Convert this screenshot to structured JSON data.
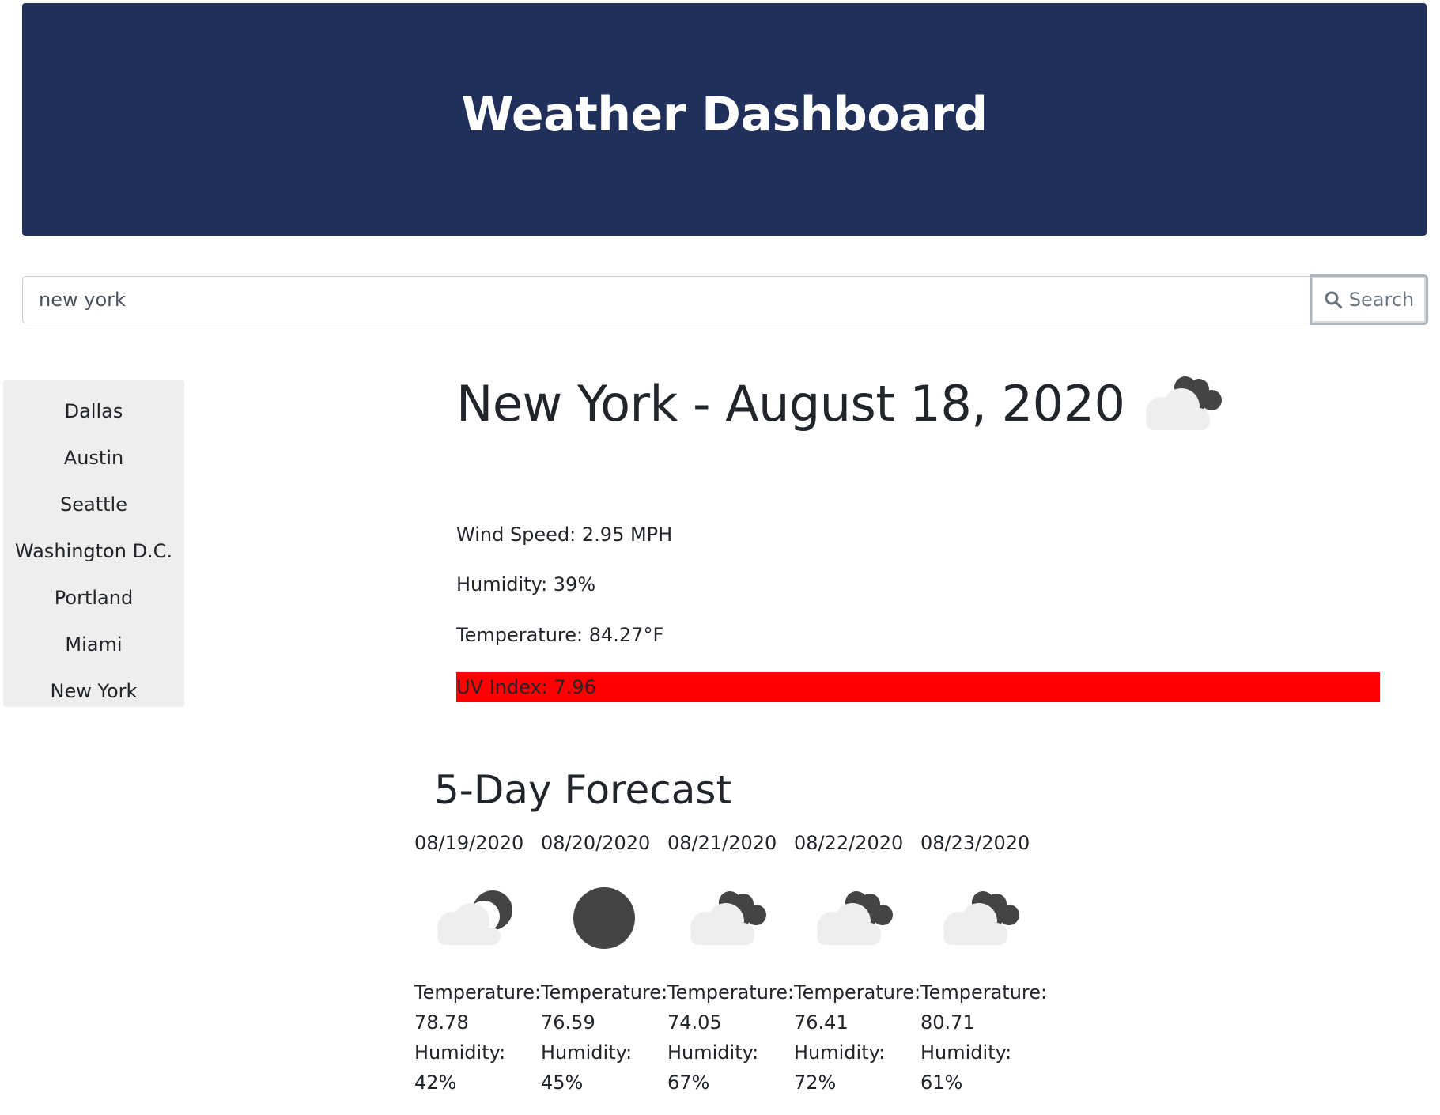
{
  "header": {
    "title": "Weather Dashboard"
  },
  "search": {
    "value": "new york",
    "button_label": "Search",
    "button_icon": "search-icon"
  },
  "sidebar": {
    "items": [
      {
        "label": "Dallas"
      },
      {
        "label": "Austin"
      },
      {
        "label": "Seattle"
      },
      {
        "label": "Washington D.C."
      },
      {
        "label": "Portland"
      },
      {
        "label": "Miami"
      },
      {
        "label": "New York"
      }
    ]
  },
  "current": {
    "title": "New York - August 18, 2020",
    "icon": "partly-cloudy-night-icon",
    "wind": "Wind Speed: 2.95 MPH",
    "humidity": "Humidity: 39%",
    "temperature": "Temperature: 84.27°F",
    "uv": "UV Index: 7.96",
    "uv_color": "#ff0000"
  },
  "forecast": {
    "title": "5-Day Forecast",
    "days": [
      {
        "date": "08/19/2020",
        "icon": "cloud-moon-icon",
        "temp_label": "Temperature:",
        "temp": "78.78",
        "hum_label": "Humidity:",
        "hum": "42%"
      },
      {
        "date": "08/20/2020",
        "icon": "clear-night-icon",
        "temp_label": "Temperature:",
        "temp": "76.59",
        "hum_label": "Humidity:",
        "hum": "45%"
      },
      {
        "date": "08/21/2020",
        "icon": "partly-cloudy-night-icon",
        "temp_label": "Temperature:",
        "temp": "74.05",
        "hum_label": "Humidity:",
        "hum": "67%"
      },
      {
        "date": "08/22/2020",
        "icon": "partly-cloudy-night-icon",
        "temp_label": "Temperature:",
        "temp": "76.41",
        "hum_label": "Humidity:",
        "hum": "72%"
      },
      {
        "date": "08/23/2020",
        "icon": "partly-cloudy-night-icon",
        "temp_label": "Temperature:",
        "temp": "80.71",
        "hum_label": "Humidity:",
        "hum": "61%"
      }
    ]
  },
  "colors": {
    "header_bg": "#21305a",
    "sidebar_bg": "#eeeeee",
    "uv_high": "#ff0000"
  }
}
